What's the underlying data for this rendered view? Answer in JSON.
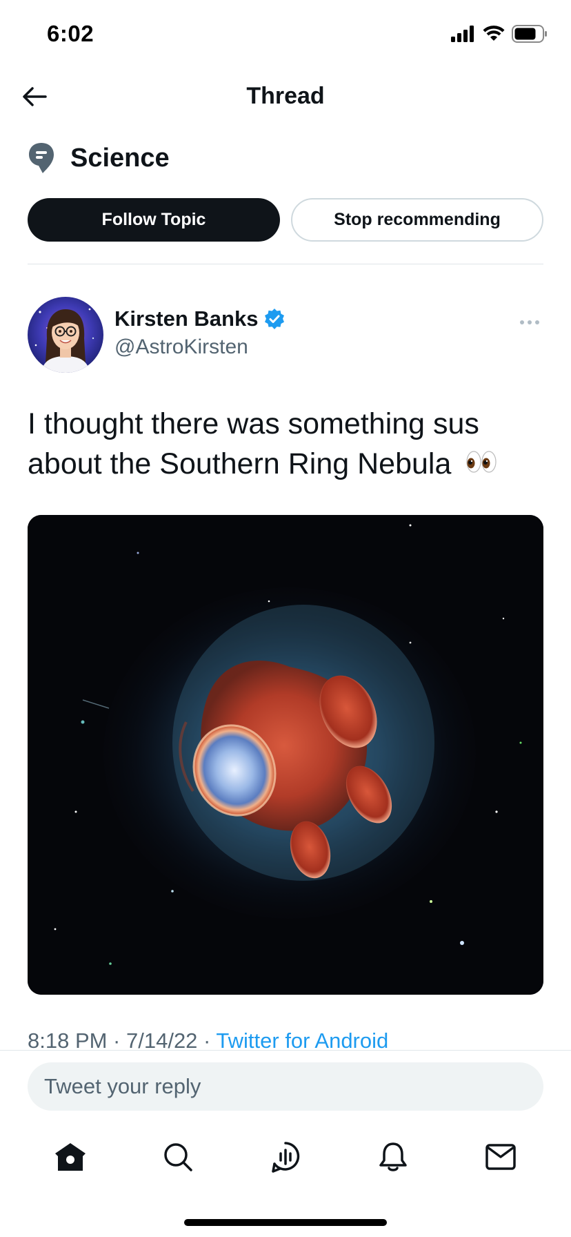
{
  "status_bar": {
    "time": "6:02",
    "icons": [
      "signal-icon",
      "wifi-icon",
      "battery-icon"
    ]
  },
  "header": {
    "back_icon": "back-arrow-icon",
    "title": "Thread"
  },
  "topic": {
    "icon": "topic-icon",
    "name": "Science",
    "follow_label": "Follow Topic",
    "stop_label": "Stop recommending"
  },
  "tweet": {
    "author_name": "Kirsten Banks",
    "verified": true,
    "handle": "@AstroKirsten",
    "text": "I thought there was something sus about the Southern Ring Nebula",
    "emoji": "👀",
    "timestamp": "8:18 PM · 7/14/22 · ",
    "source": "Twitter for Android"
  },
  "reply": {
    "placeholder": "Tweet your reply"
  },
  "tab_bar": {
    "items": [
      "home-icon",
      "search-icon",
      "spaces-icon",
      "notifications-icon",
      "messages-icon"
    ]
  },
  "colors": {
    "accent": "#1d9bf0",
    "text_primary": "#0f1419",
    "text_secondary": "#536471",
    "button_dark": "#0f1419"
  }
}
